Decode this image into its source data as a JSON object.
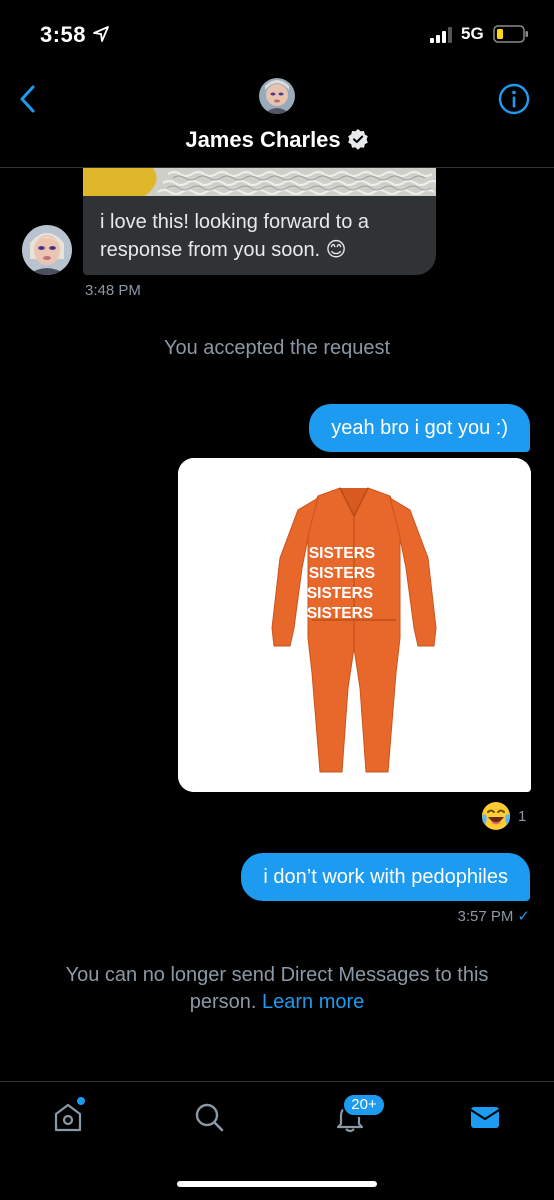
{
  "status_bar": {
    "time": "3:58",
    "network": "5G",
    "icons": [
      "location-arrow-icon",
      "signal-icon",
      "battery-icon"
    ]
  },
  "header": {
    "contact_name": "James Charles",
    "icons": [
      "back-chevron-icon",
      "info-icon",
      "verified-badge-icon"
    ]
  },
  "messages": {
    "received": {
      "text": "i love this! looking forward to a response from you soon. 😊",
      "time": "3:48 PM"
    },
    "system_note": "You accepted the request",
    "sent_1": "yeah bro i got you :)",
    "sent_image": {
      "lines": [
        "SISTERS",
        "SISTERS",
        "SISTERS",
        "SISTERS"
      ]
    },
    "reaction": {
      "emoji": "😂",
      "count": "1"
    },
    "sent_2": "i don’t work with pedophiles",
    "sent_time": "3:57 PM",
    "read_mark": "✓"
  },
  "footer_notice": {
    "text": "You can no longer send Direct Messages to this person.",
    "link": "Learn more"
  },
  "bottom_nav": {
    "notification_badge": "20+",
    "icons": [
      "home-icon",
      "search-icon",
      "notifications-icon",
      "messages-icon"
    ]
  },
  "colors": {
    "background": "#000000",
    "accent": "#1d9bf0",
    "bubble_received": "#2f3336",
    "muted_text": "#8b98a5",
    "jumpsuit": "#ea6a2c"
  }
}
